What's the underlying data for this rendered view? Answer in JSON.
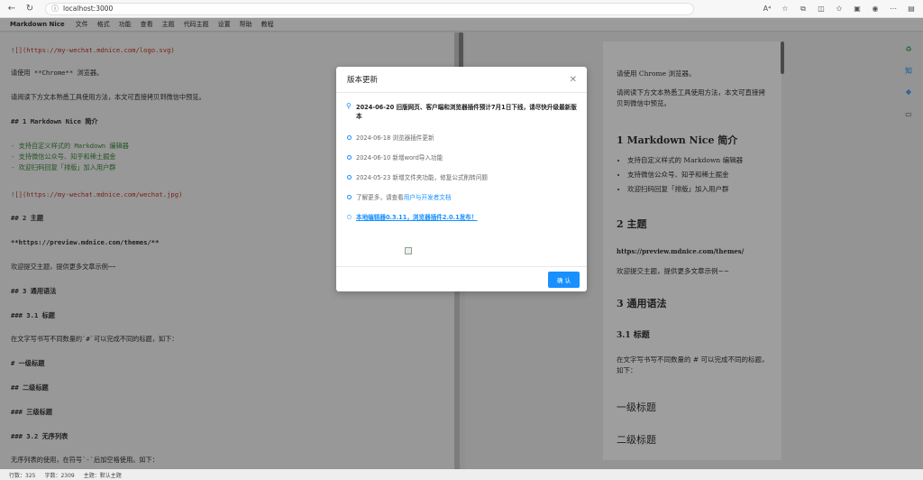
{
  "browser": {
    "url": "localhost:3000",
    "read_aloud": "A⁴"
  },
  "menu": {
    "brand": "Markdown Nice",
    "items": [
      "文件",
      "格式",
      "功能",
      "查看",
      "主题",
      "代码主题",
      "设置",
      "帮助",
      "教程"
    ]
  },
  "editor": {
    "lines": [
      "![](https://my-wechat.mdnice.com/logo.svg)",
      "请使用 **Chrome** 浏览器。",
      "请阅读下方文本熟悉工具使用方法，本文可直接拷贝到微信中预览。",
      "## 1 Markdown Nice 简介",
      "- 支持自定义样式的 Markdown 编辑器",
      "- 支持微信公众号、知乎和稀土掘金",
      "- 欢迎扫码回复「排版」加入用户群",
      "![](https://my-wechat.mdnice.com/wechat.jpg)",
      "## 2 主题",
      "**https://preview.mdnice.com/themes/**",
      "欢迎提交主题，提供更多文章示例~~",
      "## 3 通用语法",
      "### 3.1 标题",
      "在文字写书写不同数量的`#`可以完成不同的标题，如下：",
      "# 一级标题",
      "## 二级标题",
      "### 三级标题",
      "### 3.2 无序列表",
      "无序列表的使用，在符号`-`后加空格使用。如下："
    ]
  },
  "preview": {
    "p1": "请使用 Chrome 浏览器。",
    "p2": "请阅读下方文本熟悉工具使用方法，本文可直接拷贝到微信中预览。",
    "h1_1": "1 Markdown Nice 简介",
    "li1": "支持自定义样式的 Markdown 编辑器",
    "li2": "支持微信公众号、知乎和稀土掘金",
    "li3": "欢迎扫码回复「排版」加入用户群",
    "h1_2": "2 主题",
    "link": "https://preview.mdnice.com/themes/",
    "p3": "欢迎提交主题，提供更多文章示例~~",
    "h1_3": "3 通用语法",
    "h2_1": "3.1 标题",
    "p4": "在文字写书写不同数量的 # 可以完成不同的标题，如下：",
    "big1": "一级标题",
    "big2": "二级标题"
  },
  "status": {
    "lines": "行数：325",
    "chars": "字数：2309",
    "theme": "主题：默认主题"
  },
  "modal": {
    "title": "版本更新",
    "items": [
      "2024-06-20 旧版网页、客户端和浏览器插件预计7月1日下线，请尽快升级最新版本",
      "2024-06-18 浏览器插件更新",
      "2024-06-10 新增word导入功能",
      "2024-05-23 新增文件夹功能，修复公式削转问题",
      "了解更多，请查看",
      "本地编辑器0.3.11，浏览器插件2.0.1发布！"
    ],
    "more_link": "用户与开发者文档",
    "ok": "确 认"
  },
  "colors": {
    "accent": "#1890ff",
    "overlay": "rgba(0,0,0,0.38)"
  }
}
